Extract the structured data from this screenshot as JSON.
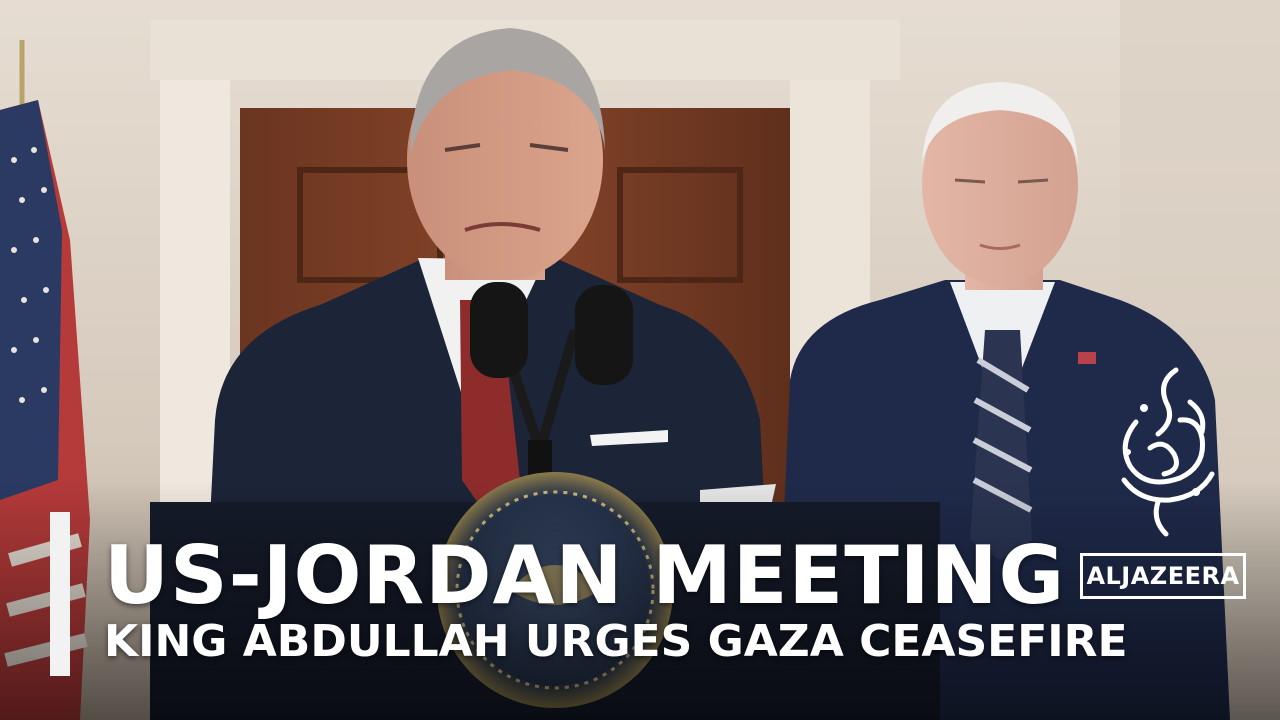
{
  "headline": "US-JORDAN MEETING",
  "subheadline": "KING ABDULLAH URGES GAZA CEASEFIRE",
  "logo": {
    "wordmark": "ALJAZEERA",
    "emblem_icon": "al-jazeera-calligraphy-icon"
  },
  "colors": {
    "text": "#ffffff",
    "accent_bar": "#f2f2f2",
    "suit_navy": "#1c2438",
    "tie_red": "#8e2c2c",
    "door_wood": "#7a3e24",
    "wall": "#d9cfc3"
  }
}
